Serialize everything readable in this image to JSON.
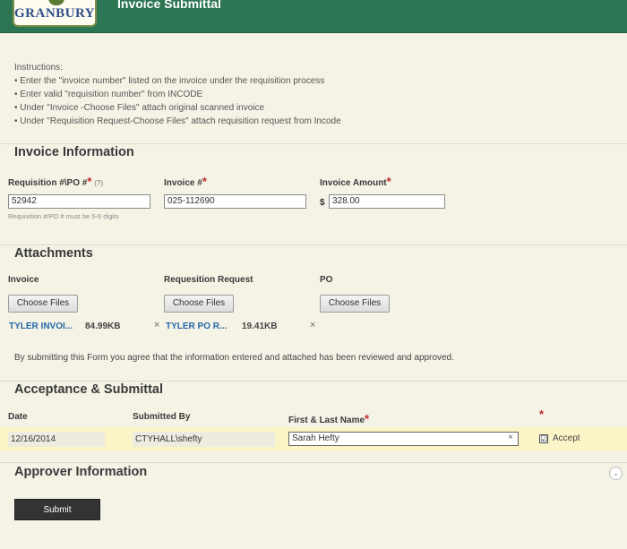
{
  "header": {
    "logo_text": "GRANBURY",
    "title": "Invoice Submittal"
  },
  "instructions": {
    "heading": "Instructions:",
    "items": [
      "• Enter the \"invoice number\" listed on the invoice under the requisition process",
      "• Enter valid \"requisition number\" from INCODE",
      "• Under \"Invoice -Choose Files\" attach original scanned invoice",
      "• Under \"Requisition Request-Choose Files\" attach requisition request from Incode"
    ]
  },
  "invoice_info": {
    "title": "Invoice Information",
    "requisition": {
      "label": "Requisition #\\PO #",
      "required_mark": "*",
      "help_mark": "(?)",
      "value": "52942",
      "hint": "Requisition #/PO # must be 5-6 digits"
    },
    "invoice_number": {
      "label": "Invoice #",
      "required_mark": "*",
      "value": "025-112690"
    },
    "invoice_amount": {
      "label": "Invoice Amount",
      "required_mark": "*",
      "currency": "$",
      "value": "328.00"
    }
  },
  "attachments": {
    "title": "Attachments",
    "columns": [
      {
        "label": "Invoice",
        "button": "Choose Files",
        "file_name": "TYLER INVOI...",
        "file_size": "84.99KB",
        "remove": "×"
      },
      {
        "label": "Requesition Request",
        "button": "Choose Files",
        "file_name": "TYLER PO R...",
        "file_size": "19.41KB",
        "remove": "×"
      },
      {
        "label": "PO",
        "button": "Choose Files"
      }
    ]
  },
  "agreement_text": "By submitting this Form you agree that the information entered and attached has been reviewed and approved.",
  "acceptance": {
    "title": "Acceptance & Submittal",
    "date_label": "Date",
    "date_value": "12/16/2014",
    "submitted_by_label": "Submitted By",
    "submitted_by_value": "CTYHALL\\shefty",
    "name_label": "First & Last Name",
    "name_required": "*",
    "name_value": "Sarah Hefty",
    "name_clear": "×",
    "accept_required": "*",
    "accept_checked": "☑",
    "accept_label": "Accept"
  },
  "approver": {
    "title": "Approver Information",
    "toggle": "⌄"
  },
  "submit_label": "Submit",
  "colors": {
    "header_bg": "#2d7653",
    "page_bg": "#f5f3e6",
    "required": "#c0282f",
    "link": "#2368a8",
    "highlight_row": "#fbf4c6"
  }
}
